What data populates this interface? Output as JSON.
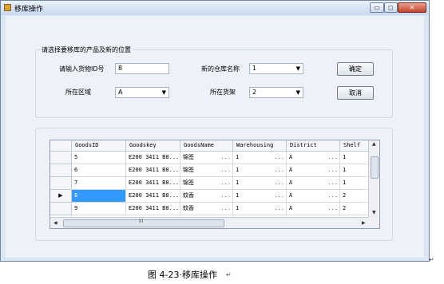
{
  "window": {
    "title": "移库操作",
    "minimize_glyph": "▭",
    "maximize_glyph": "◻",
    "close_glyph": "✕"
  },
  "form": {
    "group_title": "请选择要移库的产品及新的位置",
    "goods_id_label": "请输入货物ID号",
    "goods_id_value": "8",
    "warehouse_label": "新的仓库名称",
    "warehouse_value": "1",
    "district_label": "所在区域",
    "district_value": "A",
    "shelf_label": "所在货架",
    "shelf_value": "2",
    "ok_label": "确定",
    "cancel_label": "取消"
  },
  "grid": {
    "columns": [
      "GoodsID",
      "Goodskey",
      "GoodsName",
      "Warehousing",
      "District",
      "Shelf"
    ],
    "rows": [
      {
        "GoodsID": "5",
        "Goodskey": "E200 3411 B8...",
        "GoodsName": "锦签",
        "Warehousing": "1",
        "District": "A",
        "Shelf": "1",
        "current": false
      },
      {
        "GoodsID": "6",
        "Goodskey": "E200 3411 B8...",
        "GoodsName": "锦签",
        "Warehousing": "1",
        "District": "A",
        "Shelf": "1",
        "current": false
      },
      {
        "GoodsID": "7",
        "Goodskey": "E200 3411 B8...",
        "GoodsName": "锦签",
        "Warehousing": "1",
        "District": "A",
        "Shelf": "1",
        "current": false
      },
      {
        "GoodsID": "8",
        "Goodskey": "E200 3411 B8...",
        "GoodsName": "蚊香",
        "Warehousing": "1",
        "District": "A",
        "Shelf": "2",
        "current": true
      },
      {
        "GoodsID": "9",
        "Goodskey": "E200 3411 B8...",
        "GoodsName": "蚊香",
        "Warehousing": "1",
        "District": "A",
        "Shelf": "2",
        "current": false
      }
    ],
    "ellipsis": "...",
    "current_row_marker": "▶",
    "hscroll_grip": "III"
  },
  "caption": {
    "text": "图 4-23·移库操作"
  },
  "colors": {
    "selected_cell": "#3399ff",
    "selected_text": "#ffffff"
  }
}
